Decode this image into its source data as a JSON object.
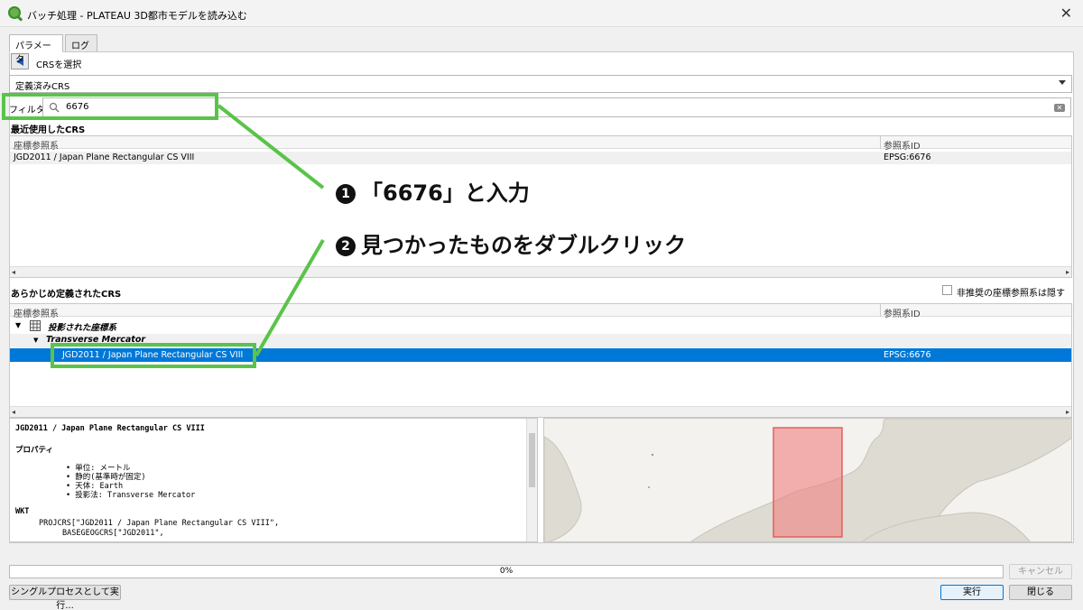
{
  "window": {
    "title": "バッチ処理 - PLATEAU 3D都市モデルを読み込む",
    "close_glyph": "✕"
  },
  "tabs": [
    "パラメータ",
    "ログ"
  ],
  "crs_select_label": "CRSを選択",
  "crs_combo": {
    "value": "定義済みCRS"
  },
  "filter": {
    "label": "フィルタ",
    "value": "6676"
  },
  "recent": {
    "title": "最近使用したCRS",
    "columns": [
      "座標参照系",
      "参照系ID"
    ],
    "rows": [
      {
        "name": "JGD2011 / Japan Plane Rectangular CS VIII",
        "id": "EPSG:6676"
      }
    ]
  },
  "predefined": {
    "title": "あらかじめ定義されたCRS",
    "hide_deprecated_label": "非推奨の座標参照系は隠す",
    "columns": [
      "座標参照系",
      "参照系ID"
    ],
    "group": "投影された座標系",
    "subgroup": "Transverse Mercator",
    "selected": {
      "name": "JGD2011 / Japan Plane Rectangular CS VIII",
      "id": "EPSG:6676"
    }
  },
  "info": {
    "title": "JGD2011 / Japan Plane Rectangular CS VIII",
    "properties_heading": "プロパティ",
    "properties": [
      "• 単位: メートル",
      "• 静的(基準時が固定)",
      "• 天体: Earth",
      "• 投影法: Transverse Mercator"
    ],
    "wkt_heading": "WKT",
    "wkt_lines": [
      "PROJCRS[\"JGD2011 / Japan Plane Rectangular CS VIII\",",
      "BASEGEOGCRS[\"JGD2011\","
    ]
  },
  "progress": {
    "text": "0%",
    "value": 0
  },
  "buttons": {
    "cancel": "キャンセル",
    "single": "シングルプロセスとして実行...",
    "run": "実行",
    "close": "閉じる"
  },
  "annotations": {
    "step1": {
      "num": "1",
      "text": "「6676」と入力"
    },
    "step2": {
      "num": "2",
      "text": "見つかったものをダブルクリック"
    }
  },
  "colors": {
    "highlight": "#5ac34a",
    "selection": "#0078d7",
    "extent": "#f08080"
  }
}
